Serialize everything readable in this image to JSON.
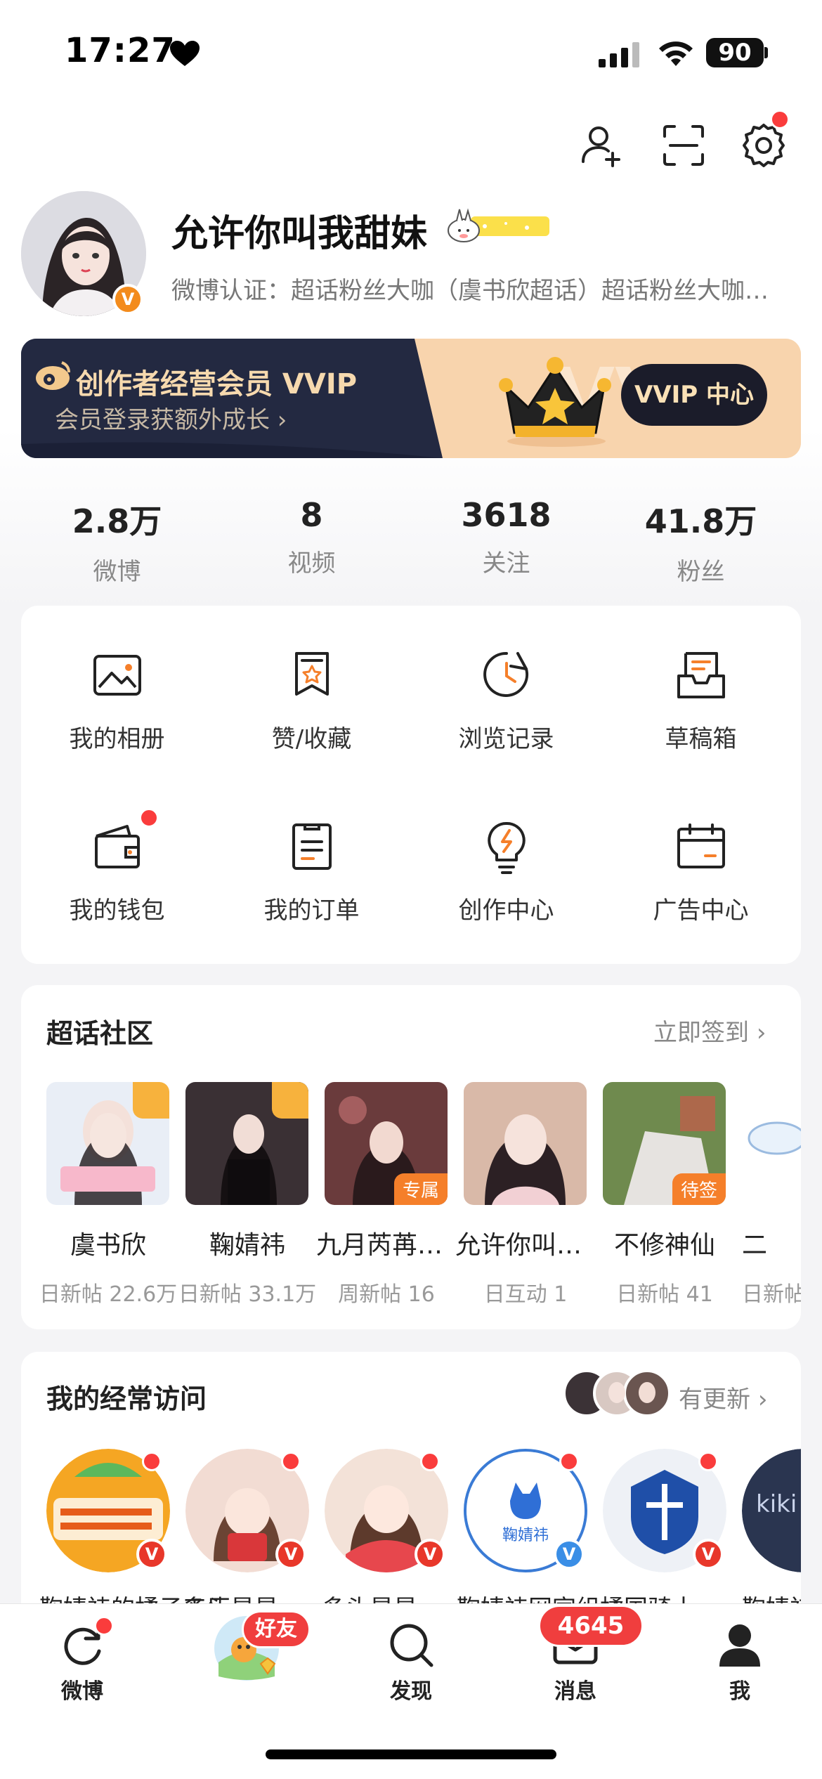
{
  "status_bar": {
    "time": "17:27",
    "battery": "90"
  },
  "profile": {
    "username": "允许你叫我甜妹",
    "verified_badge": "V",
    "verification": "微博认证：超话粉丝大咖（虞书欣超话）超话粉丝大咖（鞠婧祎超话）"
  },
  "vvip": {
    "title": "创作者经营会员 VVIP",
    "subtitle": "会员登录获额外成长 ›",
    "button": "VVIP 中心"
  },
  "stats": [
    {
      "value": "2.8万",
      "label": "微博"
    },
    {
      "value": "8",
      "label": "视频"
    },
    {
      "value": "3618",
      "label": "关注"
    },
    {
      "value": "41.8万",
      "label": "粉丝"
    }
  ],
  "tools": [
    {
      "label": "我的相册",
      "icon": "photo-icon"
    },
    {
      "label": "赞/收藏",
      "icon": "bookmark-icon"
    },
    {
      "label": "浏览记录",
      "icon": "history-icon"
    },
    {
      "label": "草稿箱",
      "icon": "draft-icon"
    },
    {
      "label": "我的钱包",
      "icon": "wallet-icon"
    },
    {
      "label": "我的订单",
      "icon": "order-icon"
    },
    {
      "label": "创作中心",
      "icon": "bulb-icon"
    },
    {
      "label": "广告中心",
      "icon": "calendar-icon"
    }
  ],
  "supertopic": {
    "title": "超话社区",
    "link": "立即签到",
    "items": [
      {
        "name": "虞书欣",
        "meta": "日新帖 22.6万",
        "tag": ""
      },
      {
        "name": "鞠婧祎",
        "meta": "日新帖 33.1万",
        "tag": ""
      },
      {
        "name": "九月芮苒苒超话",
        "meta": "周新帖 16",
        "tag": "专属"
      },
      {
        "name": "允许你叫我甜妹",
        "meta": "日互动 1",
        "tag": ""
      },
      {
        "name": "不修神仙",
        "meta": "日新帖 41",
        "tag": "待签"
      },
      {
        "name": "二",
        "meta": "日新帖",
        "tag": ""
      }
    ]
  },
  "frequent": {
    "title": "我的经常访问",
    "link": "有更新",
    "items": [
      {
        "name": "鞠婧祎的橘子工厂",
        "badge": "V"
      },
      {
        "name": "多头星星",
        "badge": "V"
      },
      {
        "name": "多头星星",
        "badge": "V"
      },
      {
        "name": "鞠婧祎网宣组",
        "badge": "V"
      },
      {
        "name": "橘国骑士",
        "badge": "V"
      },
      {
        "name": "鞠婧祎",
        "badge": ""
      }
    ]
  },
  "tabbar": {
    "tabs": [
      {
        "label": "微博"
      },
      {
        "label": "好友"
      },
      {
        "label": "发现"
      },
      {
        "label": "消息"
      },
      {
        "label": "我"
      }
    ],
    "friend_badge": "好友",
    "message_badge": "4645"
  },
  "colors": {
    "accent": "#f57f2a",
    "red": "#fa3c3c",
    "dark": "#1e2338"
  }
}
